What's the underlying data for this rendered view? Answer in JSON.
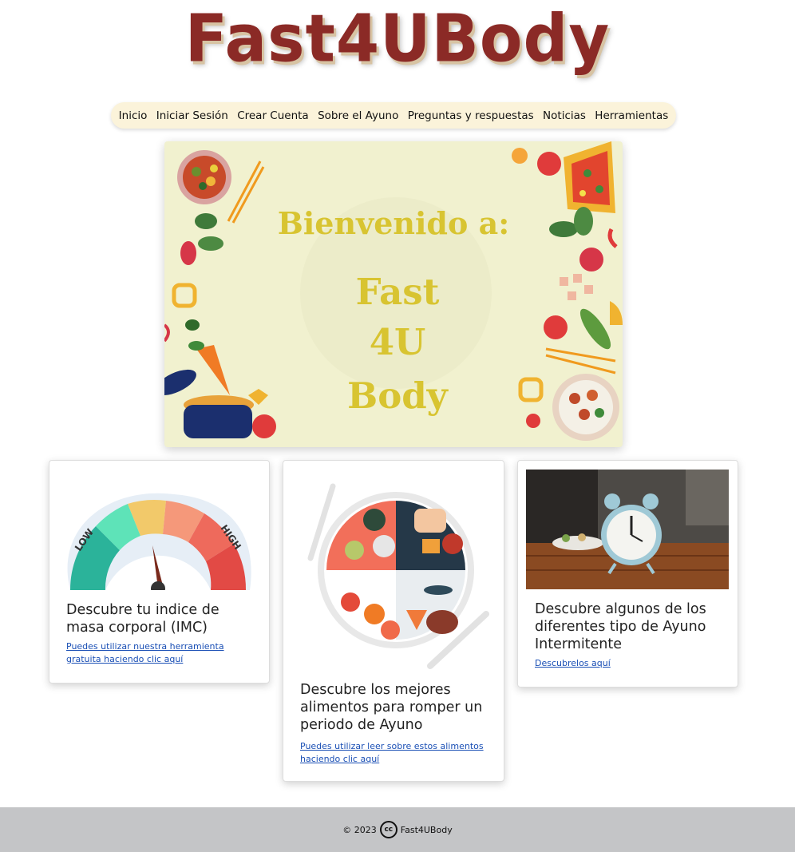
{
  "brand": {
    "title": "Fast4UBody"
  },
  "nav": {
    "items": [
      {
        "label": "Inicio"
      },
      {
        "label": "Iniciar Sesión"
      },
      {
        "label": "Crear Cuenta"
      },
      {
        "label": "Sobre el Ayuno"
      },
      {
        "label": "Preguntas y respuestas"
      },
      {
        "label": "Noticias"
      },
      {
        "label": "Herramientas"
      }
    ]
  },
  "hero": {
    "welcome": "Bienvenido a:",
    "line1": "Fast",
    "line2": "4U",
    "line3": "Body"
  },
  "cards": [
    {
      "title": "Descubre tu indice de masa corporal (IMC)",
      "link": "Puedes utilizar nuestra herramienta gratuita haciendo clic aquí",
      "gauge": {
        "low": "LOW",
        "high": "HIGH"
      }
    },
    {
      "title": "Descubre los mejores alimentos para romper un periodo de Ayuno",
      "link": "Puedes utilizar leer sobre estos alimentos haciendo clic aquí"
    },
    {
      "title": "Descubre algunos de los diferentes tipo de Ayuno Intermitente",
      "link": "Descubrelos aquí"
    }
  ],
  "footer": {
    "year": "© 2023",
    "cc": "cc",
    "name": "Fast4UBody"
  },
  "colors": {
    "brand": "#8b2a26",
    "nav_bg": "#fbf3da",
    "hero_bg": "#f1f1cf",
    "hero_text": "#d8c431",
    "link": "#1a4fb5",
    "footer_bg": "#c4c5c7"
  },
  "icons": [
    "creative-commons-icon"
  ]
}
